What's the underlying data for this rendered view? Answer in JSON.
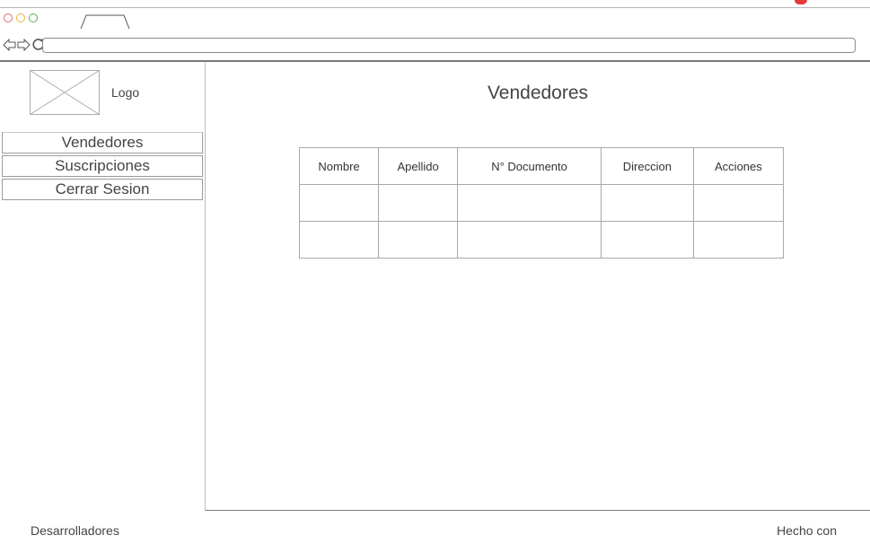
{
  "window": {
    "dots": [
      "#e06a6a",
      "#e8b23c",
      "#4fb05a"
    ]
  },
  "sidebar": {
    "logo_label": "Logo",
    "items": [
      {
        "label": "Vendedores"
      },
      {
        "label": "Suscripciones"
      },
      {
        "label": "Cerrar Sesion"
      }
    ]
  },
  "main": {
    "title": "Vendedores",
    "table": {
      "columns": [
        "Nombre",
        "Apellido",
        "N° Documento",
        "Direccion",
        "Acciones"
      ],
      "rows": [
        [
          "",
          "",
          "",
          "",
          ""
        ],
        [
          "",
          "",
          "",
          "",
          ""
        ]
      ]
    }
  },
  "footer": {
    "left": "Desarrolladores",
    "right": "Hecho con"
  }
}
